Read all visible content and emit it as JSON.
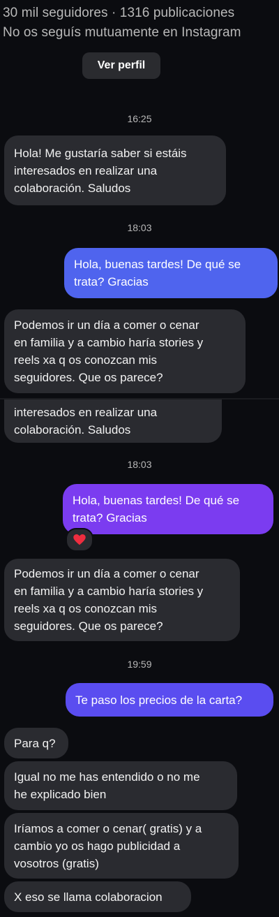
{
  "header": {
    "stats": "30 mil seguidores · 1316 publicaciones",
    "mutual": "No os seguís mutuamente en Instagram",
    "profile_button": "Ver perfil"
  },
  "colors": {
    "background": "#0b0c10",
    "incoming_bubble": "#2a2b30",
    "outgoing_blue": "#4f64ee",
    "outgoing_purple": "#7b3cf0",
    "outgoing_indigo": "#5a4df0"
  },
  "chat": {
    "time_1": "16:25",
    "msg_1": [
      "Hola! Me gustaría saber si estáis",
      "interesados en realizar una",
      "colaboración. Saludos"
    ],
    "time_2": "18:03",
    "msg_2": [
      "Hola, buenas tardes! De qué se",
      "trata? Gracias"
    ],
    "msg_3": [
      "Podemos ir un día a comer o cenar",
      "en familia y a cambio haría stories y",
      "reels xa q os conozcan mis",
      "seguidores. Que os parece?"
    ],
    "msg_1_repeat": [
      "interesados en realizar una",
      "colaboración. Saludos"
    ],
    "time_3": "18:03",
    "msg_2_repeat": [
      "Hola, buenas tardes! De qué se",
      "trata? Gracias"
    ],
    "reaction": "heart",
    "msg_3_repeat": [
      "Podemos ir un día a comer o cenar",
      "en familia y a cambio haría stories y",
      "reels xa q os conozcan mis",
      "seguidores. Que os parece?"
    ],
    "time_4": "19:59",
    "msg_4": [
      "Te paso los precios de la carta?"
    ],
    "msg_5": [
      "Para q?"
    ],
    "msg_6": [
      "Igual no me has entendido o no me",
      "he explicado bien"
    ],
    "msg_7": [
      "Iríamos a comer o cenar( gratis) y a",
      "cambio yo os hago publicidad a",
      "vosotros (gratis)"
    ],
    "msg_8": [
      "X eso se llama colaboracion"
    ]
  }
}
